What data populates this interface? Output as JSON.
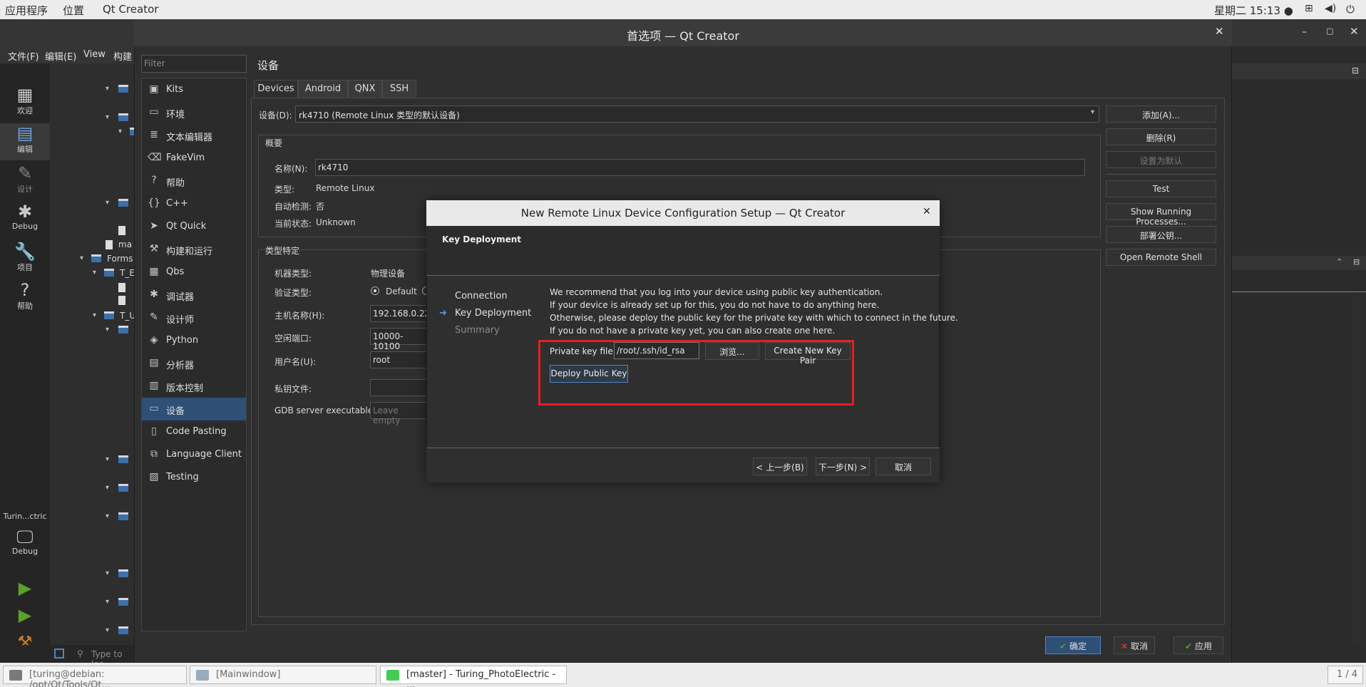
{
  "topbar": {
    "apps": "应用程序",
    "places": "位置",
    "app": "Qt Creator",
    "clock": "星期二 15:13 ●"
  },
  "bg": {
    "menu": [
      "文件(F)",
      "编辑(E)",
      "View",
      "构建("
    ],
    "projects_label": "项目",
    "modes": [
      {
        "icon": "▦",
        "label": "欢迎"
      },
      {
        "icon": "▤",
        "label": "编辑"
      },
      {
        "icon": "✎",
        "label": "设计"
      },
      {
        "icon": "✱",
        "label": "Debug"
      },
      {
        "icon": "🔧",
        "label": "项目"
      },
      {
        "icon": "?",
        "label": "帮助"
      }
    ],
    "kit_target": "Turin...ctric",
    "kit_mode": "Debug",
    "tree": {
      "ma": "ma",
      "forms": "Forms",
      "t_e": "T_E",
      "t_u": "T_U"
    },
    "search_placeholder": "Type to loc"
  },
  "prefs": {
    "title": "首选项 — Qt Creator",
    "filter_placeholder": "Filter",
    "categories": [
      {
        "icon": "▣",
        "label": "Kits"
      },
      {
        "icon": "▭",
        "label": "环境"
      },
      {
        "icon": "≣",
        "label": "文本编辑器"
      },
      {
        "icon": "⌫",
        "label": "FakeVim"
      },
      {
        "icon": "?",
        "label": "帮助"
      },
      {
        "icon": "{}",
        "label": "C++"
      },
      {
        "icon": "➤",
        "label": "Qt Quick"
      },
      {
        "icon": "⚒",
        "label": "构建和运行"
      },
      {
        "icon": "▦",
        "label": "Qbs"
      },
      {
        "icon": "✱",
        "label": "调试器"
      },
      {
        "icon": "✎",
        "label": "设计师"
      },
      {
        "icon": "◈",
        "label": "Python"
      },
      {
        "icon": "▤",
        "label": "分析器"
      },
      {
        "icon": "▥",
        "label": "版本控制"
      },
      {
        "icon": "▭",
        "label": "设备"
      },
      {
        "icon": "▯",
        "label": "Code Pasting"
      },
      {
        "icon": "⧉",
        "label": "Language Client"
      },
      {
        "icon": "▧",
        "label": "Testing"
      }
    ],
    "page_title": "设备",
    "tabs": [
      "Devices",
      "Android",
      "QNX",
      "SSH"
    ],
    "device_label": "设备(D):",
    "device_value": "rk4710 (Remote Linux 类型的默认设备)",
    "side_buttons": [
      "添加(A)...",
      "删除(R)",
      "设置为默认",
      "Test",
      "Show Running Processes...",
      "部署公钥...",
      "Open Remote Shell"
    ],
    "overview": {
      "title": "概要",
      "name_label": "名称(N):",
      "name_value": "rk4710",
      "type_label": "类型:",
      "type_value": "Remote Linux",
      "auto_label": "自动检测:",
      "auto_value": "否",
      "state_label": "当前状态:",
      "state_value": "Unknown"
    },
    "specific": {
      "title": "类型特定",
      "machine_label": "机器类型:",
      "machine_value": "物理设备",
      "auth_label": "验证类型:",
      "auth_value": "Default",
      "host_label": "主机名称(H):",
      "host_value": "192.168.0.22",
      "ports_label": "空闲端口:",
      "ports_value": "10000-10100",
      "user_label": "用户名(U):",
      "user_value": "root",
      "key_label": "私钥文件:",
      "gdb_label": "GDB server executable:",
      "gdb_placeholder": "Leave empty"
    },
    "ok": "确定",
    "cancel": "取消",
    "apply": "应用"
  },
  "wizard": {
    "title": "New Remote Linux Device Configuration Setup — Qt Creator",
    "header": "Key Deployment",
    "steps": [
      {
        "label": "Connection",
        "state": "done"
      },
      {
        "label": "Key Deployment",
        "state": "current"
      },
      {
        "label": "Summary",
        "state": "pending"
      }
    ],
    "message": [
      "We recommend that you log into your device using public key authentication.",
      "If your device is already set up for this, you do not have to do anything here.",
      "Otherwise, please deploy the public key for the private key with which to connect in the future.",
      "If you do not have a private key yet, you can also create one here."
    ],
    "pk_label": "Private key file:",
    "pk_value": "/root/.ssh/id_rsa",
    "browse": "浏览...",
    "create": "Create New Key Pair",
    "deploy": "Deploy Public Key",
    "back": "< 上一步(B)",
    "next": "下一步(N) >",
    "cancel": "取消"
  },
  "taskbar": {
    "items": [
      "[turing@debian: /opt/Qt/Tools/Qt...",
      "[Mainwindow]",
      "[master] - Turing_PhotoElectric - ..."
    ],
    "pager": "1 / 4"
  }
}
